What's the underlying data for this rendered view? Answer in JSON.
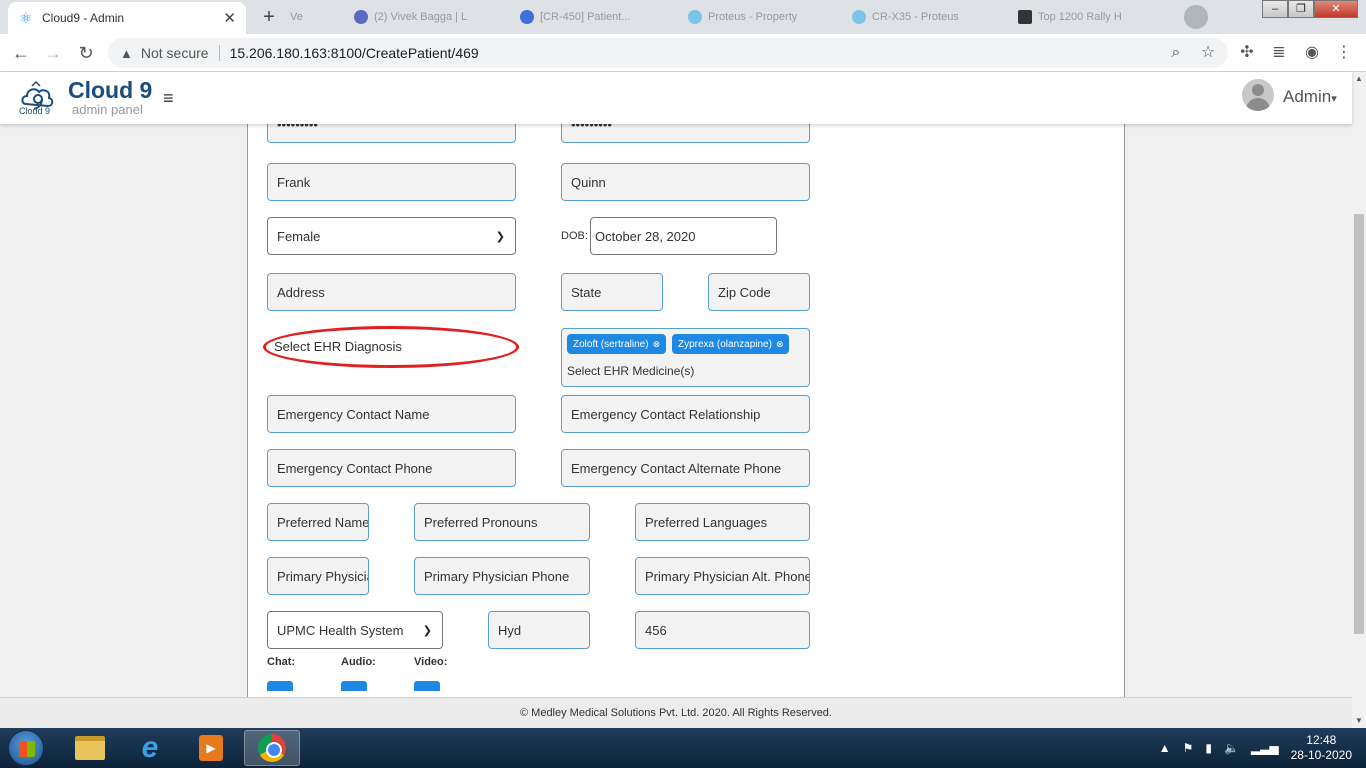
{
  "browser": {
    "tab_title": "Cloud9 - Admin",
    "tab_close": "✕",
    "new_tab": "+",
    "inactive_tabs": [
      "Ve",
      "(2) Vivek Bagga | L",
      "[CR-450] Patient...",
      "Proteus - Property",
      "CR-X35 - Proteus",
      "Top 1200 Rally H"
    ],
    "not_secure": "Not secure",
    "url": "15.206.180.163:8100/CreatePatient/469",
    "window_buttons": [
      "‒",
      "❐",
      "✕"
    ]
  },
  "app": {
    "brand": "Cloud 9",
    "brand_sub": "admin panel",
    "logo_text": "Cloud 9",
    "menu_icon": "≡",
    "user": "Admin",
    "user_caret": "▾"
  },
  "form": {
    "password": "•••••••••",
    "confirm_password": "•••••••••",
    "first_name": "Frank",
    "last_name": "Quinn",
    "gender": "Female",
    "dob_label": "DOB:",
    "dob": "October 28, 2020",
    "address": "Address",
    "state": "State",
    "zip": "Zip Code",
    "diagnosis": "Select EHR Diagnosis",
    "medicine_tags": [
      "Zoloft (sertraline)",
      "Zyprexa (olanzapine)"
    ],
    "medicine_tag_remove": "⊗",
    "medicine_placeholder": "Select EHR Medicine(s)",
    "emergency_name": "Emergency Contact Name",
    "emergency_relationship": "Emergency Contact Relationship",
    "emergency_phone": "Emergency Contact Phone",
    "emergency_alt_phone": "Emergency Contact Alternate Phone",
    "preferred_name": "Preferred Name",
    "preferred_pronouns": "Preferred Pronouns",
    "preferred_languages": "Preferred Languages",
    "primary_physician": "Primary Physician",
    "primary_physician_phone": "Primary Physician Phone",
    "primary_physician_alt_phone": "Primary Physician Alt. Phone",
    "health_system": "UPMC Health System",
    "city": "Hyd",
    "number": "456",
    "chat_label": "Chat:",
    "audio_label": "Audio:",
    "video_label": "Video:"
  },
  "footer": {
    "text": "© Medley Medical Solutions Pvt. Ltd. 2020. All Rights Reserved."
  },
  "taskbar": {
    "time": "12:48",
    "date": "28-10-2020"
  },
  "colors": {
    "accent": "#1e88e5",
    "brand": "#1a4d7a",
    "highlight": "#e02020"
  }
}
